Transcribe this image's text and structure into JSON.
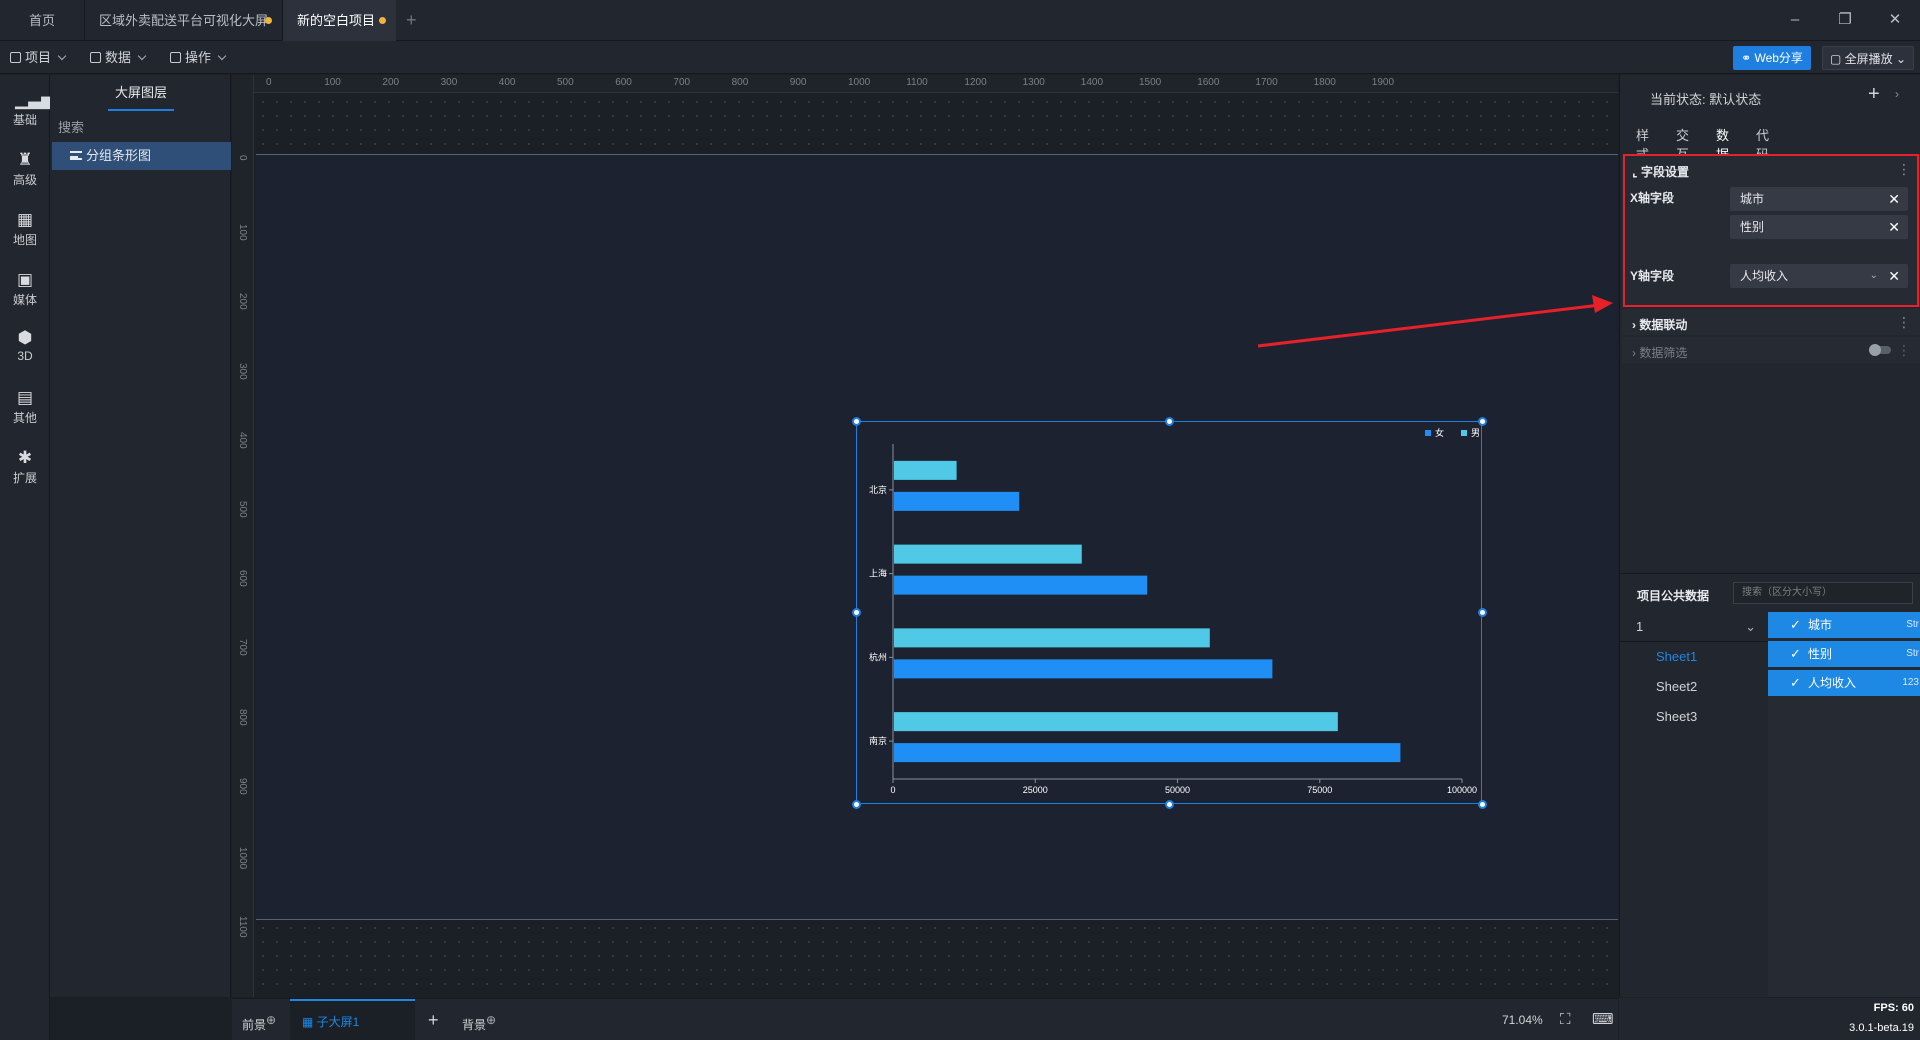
{
  "titlebar": {
    "home_tab": "首页",
    "tabs": [
      {
        "label": "区域外卖配送平台可视化大屏"
      },
      {
        "label": "新的空白项目"
      }
    ],
    "add_tab": "+"
  },
  "menubar": {
    "items": [
      {
        "label": "项目"
      },
      {
        "label": "数据"
      },
      {
        "label": "操作"
      }
    ],
    "share_label": "Web分享",
    "fullscreen_label": "全屏播放"
  },
  "iconbar": {
    "items": [
      {
        "label": "基础",
        "icon": "bar-chart-icon"
      },
      {
        "label": "高级",
        "icon": "crown-icon"
      },
      {
        "label": "地图",
        "icon": "map-icon"
      },
      {
        "label": "媒体",
        "icon": "media-icon"
      },
      {
        "label": "3D",
        "icon": "cube-icon"
      },
      {
        "label": "其他",
        "icon": "list-icon"
      },
      {
        "label": "扩展",
        "icon": "puzzle-icon"
      }
    ]
  },
  "layers": {
    "title": "大屏图层",
    "search_placeholder": "搜索",
    "items": [
      {
        "label": "分组条形图"
      }
    ]
  },
  "ruler": {
    "top": [
      "0",
      "100",
      "200",
      "300",
      "400",
      "500",
      "600",
      "700",
      "800",
      "900",
      "1000",
      "1100",
      "1200",
      "1300",
      "1400",
      "1500",
      "1600",
      "1700",
      "1800",
      "1900"
    ],
    "left": [
      "0",
      "100",
      "200",
      "300",
      "400",
      "500",
      "600",
      "700",
      "800",
      "900",
      "1000",
      "1100"
    ]
  },
  "chart_data": {
    "type": "bar",
    "orientation": "horizontal",
    "categories": [
      "北京",
      "上海",
      "杭州",
      "南京"
    ],
    "series": [
      {
        "name": "女",
        "values": [
          11000,
          33000,
          55500,
          78000
        ]
      },
      {
        "name": "男",
        "values": [
          22000,
          44500,
          66500,
          89000
        ]
      }
    ],
    "xticks": [
      "0",
      "25000",
      "50000",
      "75000",
      "100000"
    ],
    "xlim": [
      0,
      100000
    ],
    "legend": "top-right",
    "colors": {
      "女": "#4fc9e6",
      "男": "#1f8ff5"
    }
  },
  "rightpanel": {
    "state_label": "当前状态:",
    "state_value": "默认状态",
    "tabs": [
      {
        "label": "样式"
      },
      {
        "label": "交互"
      },
      {
        "label": "数据"
      },
      {
        "label": "代码"
      }
    ],
    "field_section": {
      "title": "字段设置",
      "x_label": "X轴字段",
      "x_fields": [
        {
          "label": "城市"
        },
        {
          "label": "性别"
        }
      ],
      "y_label": "Y轴字段",
      "y_field": "人均收入"
    },
    "linkage_title": "数据联动",
    "filter_title": "数据筛选",
    "public_data": {
      "title": "项目公共数据",
      "search_placeholder": "搜索（区分大小写）",
      "selector": "1",
      "sheets": [
        {
          "label": "Sheet1"
        },
        {
          "label": "Sheet2"
        },
        {
          "label": "Sheet3"
        }
      ],
      "columns": [
        {
          "label": "城市",
          "type": "Str"
        },
        {
          "label": "性别",
          "type": "Str"
        },
        {
          "label": "人均收入",
          "type": "123"
        }
      ]
    }
  },
  "bottombar": {
    "foreground": "前景",
    "active_screen": "子大屏1",
    "add": "+",
    "background": "背景",
    "zoom": "71.04%"
  },
  "status": {
    "fps": "FPS: 60",
    "version": "3.0.1-beta.19"
  }
}
